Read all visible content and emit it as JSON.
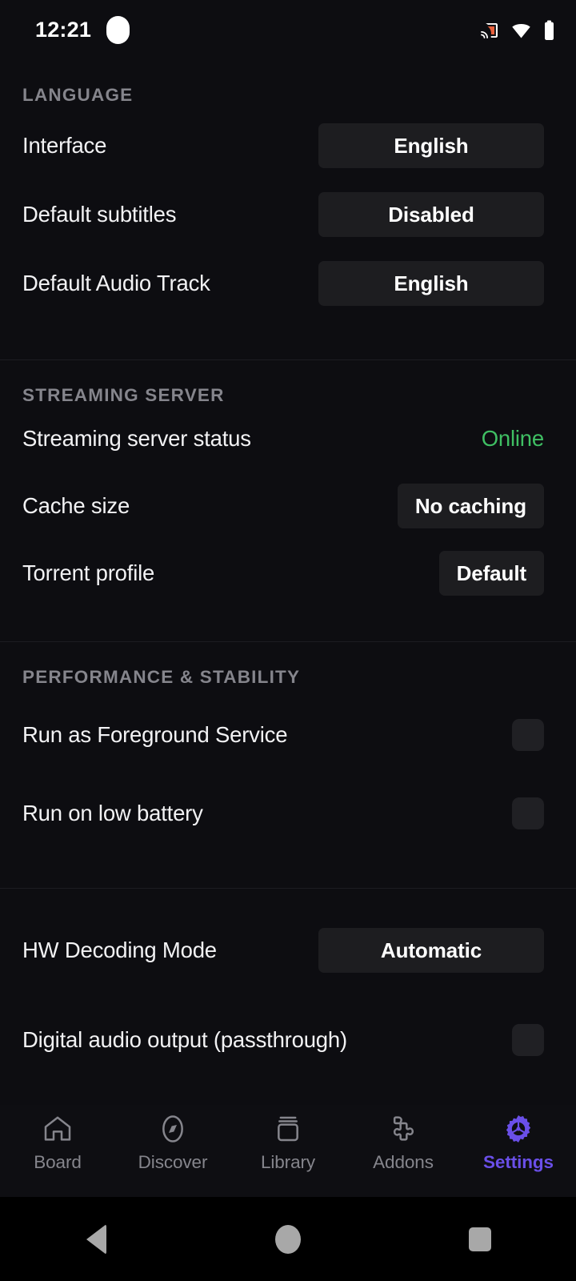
{
  "status_bar": {
    "time": "12:21",
    "icons": [
      "cast-icon",
      "wifi-icon",
      "battery-icon"
    ],
    "cast_color": "#e8603c"
  },
  "colors": {
    "background": "#0d0d11",
    "button_bg": "#1d1d20",
    "section_header": "#85858c",
    "label": "#f2f2f4",
    "online_green": "#3fbf63",
    "accent_purple": "#6a4fe8",
    "divider": "#1c1c22"
  },
  "sections": [
    {
      "header": "LANGUAGE",
      "rows": [
        {
          "label": "Interface",
          "value": "English",
          "type": "select",
          "wide": true
        },
        {
          "label": "Default subtitles",
          "value": "Disabled",
          "type": "select",
          "wide": true
        },
        {
          "label": "Default Audio Track",
          "value": "English",
          "type": "select",
          "wide": true
        }
      ]
    },
    {
      "header": "STREAMING SERVER",
      "rows": [
        {
          "label": "Streaming server status",
          "value": "Online",
          "type": "status"
        },
        {
          "label": "Cache size",
          "value": "No caching",
          "type": "select",
          "wide": false
        },
        {
          "label": "Torrent profile",
          "value": "Default",
          "type": "select",
          "wide": false
        }
      ]
    },
    {
      "header": "PERFORMANCE & STABILITY",
      "rows": [
        {
          "label": "Run as Foreground Service",
          "value": "",
          "type": "checkbox",
          "checked": false
        },
        {
          "label": "Run on low battery",
          "value": "",
          "type": "checkbox",
          "checked": false
        }
      ]
    },
    {
      "header": "",
      "rows": [
        {
          "label": "HW Decoding Mode",
          "value": "Automatic",
          "type": "select",
          "wide": true
        },
        {
          "label": "Digital audio output (passthrough)",
          "value": "",
          "type": "checkbox",
          "checked": false
        }
      ]
    }
  ],
  "tabbar": {
    "items": [
      {
        "label": "Board",
        "icon": "home-icon",
        "active": false
      },
      {
        "label": "Discover",
        "icon": "compass-icon",
        "active": false
      },
      {
        "label": "Library",
        "icon": "archive-box-icon",
        "active": false
      },
      {
        "label": "Addons",
        "icon": "puzzle-piece-icon",
        "active": false
      },
      {
        "label": "Settings",
        "icon": "gear-icon",
        "active": true
      }
    ]
  },
  "android_nav": {
    "back": "back-triangle-icon",
    "home": "home-circle-icon",
    "recents": "recents-square-icon"
  }
}
